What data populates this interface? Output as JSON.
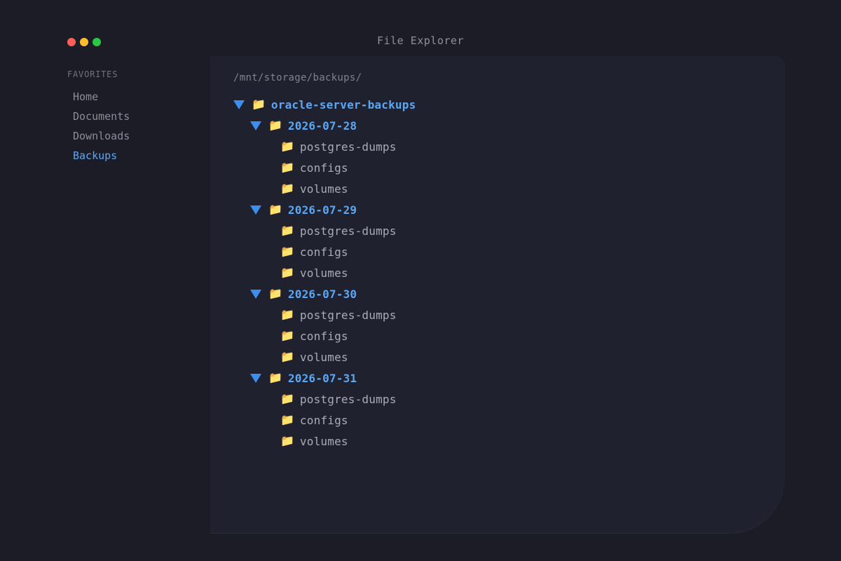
{
  "window": {
    "title": "File Explorer",
    "traffic_lights": {
      "close_color": "#ff5f57",
      "minimize_color": "#febc2e",
      "maximize_color": "#28c840"
    }
  },
  "sidebar": {
    "heading": "FAVORITES",
    "items": [
      {
        "label": "Home",
        "active": false
      },
      {
        "label": "Documents",
        "active": false
      },
      {
        "label": "Downloads",
        "active": false
      },
      {
        "label": "Backups",
        "active": true
      }
    ]
  },
  "main": {
    "path": "/mnt/storage/backups/",
    "tree": {
      "root": {
        "label": "oracle-server-backups",
        "icon": "folder-icon",
        "expanded": true
      },
      "dates": [
        {
          "label": "2026-07-28",
          "icon": "folder-icon",
          "expanded": true,
          "children": [
            {
              "label": "postgres-dumps"
            },
            {
              "label": "configs"
            },
            {
              "label": "volumes"
            }
          ]
        },
        {
          "label": "2026-07-29",
          "icon": "folder-icon",
          "expanded": true,
          "children": [
            {
              "label": "postgres-dumps"
            },
            {
              "label": "configs"
            },
            {
              "label": "volumes"
            }
          ]
        },
        {
          "label": "2026-07-30",
          "icon": "folder-icon",
          "expanded": true,
          "children": [
            {
              "label": "postgres-dumps"
            },
            {
              "label": "configs"
            },
            {
              "label": "volumes"
            }
          ]
        },
        {
          "label": "2026-07-31",
          "icon": "folder-icon",
          "expanded": true,
          "children": [
            {
              "label": "postgres-dumps"
            },
            {
              "label": "configs"
            },
            {
              "label": "volumes"
            }
          ]
        }
      ]
    }
  },
  "colors": {
    "accent": "#5aa7f5",
    "arrow": "#3e8ef0",
    "text_muted": "#a9acb8",
    "background": "#1b1c26",
    "panel": "#20212e"
  }
}
